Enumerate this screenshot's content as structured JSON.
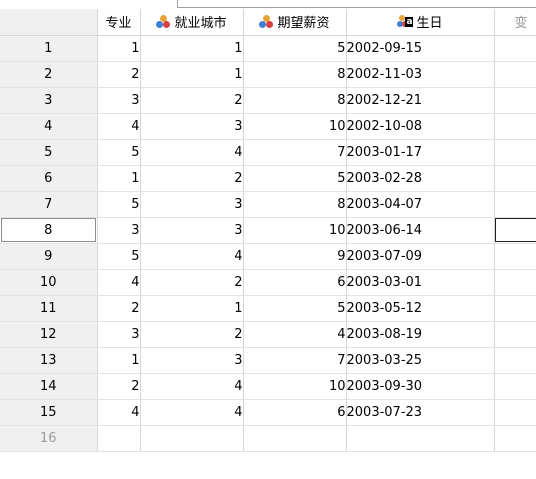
{
  "columns": {
    "major": "专业",
    "city": "就业城市",
    "salary": "期望薪资",
    "birthday": "生日",
    "next": "变"
  },
  "icons": {
    "city": "nominal-measure-icon",
    "salary": "nominal-measure-icon",
    "birthday": "string-variable-icon"
  },
  "colors": {
    "grid_line": "#d6d6d6",
    "row_header_bg": "#f0f0f0",
    "ghost_text": "#9a9a9a"
  },
  "rows": [
    {
      "n": "1",
      "major": "1",
      "city": "1",
      "salary": "5",
      "birthday": "2002-09-15"
    },
    {
      "n": "2",
      "major": "2",
      "city": "1",
      "salary": "8",
      "birthday": "2002-11-03"
    },
    {
      "n": "3",
      "major": "3",
      "city": "2",
      "salary": "8",
      "birthday": "2002-12-21"
    },
    {
      "n": "4",
      "major": "4",
      "city": "3",
      "salary": "10",
      "birthday": "2002-10-08"
    },
    {
      "n": "5",
      "major": "5",
      "city": "4",
      "salary": "7",
      "birthday": "2003-01-17"
    },
    {
      "n": "6",
      "major": "1",
      "city": "2",
      "salary": "5",
      "birthday": "2003-02-28"
    },
    {
      "n": "7",
      "major": "5",
      "city": "3",
      "salary": "8",
      "birthday": "2003-04-07"
    },
    {
      "n": "8",
      "major": "3",
      "city": "3",
      "salary": "10",
      "birthday": "2003-06-14"
    },
    {
      "n": "9",
      "major": "5",
      "city": "4",
      "salary": "9",
      "birthday": "2003-07-09"
    },
    {
      "n": "10",
      "major": "4",
      "city": "2",
      "salary": "6",
      "birthday": "2003-03-01"
    },
    {
      "n": "11",
      "major": "2",
      "city": "1",
      "salary": "5",
      "birthday": "2003-05-12"
    },
    {
      "n": "12",
      "major": "3",
      "city": "2",
      "salary": "4",
      "birthday": "2003-08-19"
    },
    {
      "n": "13",
      "major": "1",
      "city": "3",
      "salary": "7",
      "birthday": "2003-03-25"
    },
    {
      "n": "14",
      "major": "2",
      "city": "4",
      "salary": "10",
      "birthday": "2003-09-30"
    },
    {
      "n": "15",
      "major": "4",
      "city": "4",
      "salary": "6",
      "birthday": "2003-07-23"
    }
  ],
  "empty_row": {
    "n": "16"
  },
  "selected_row": "8"
}
